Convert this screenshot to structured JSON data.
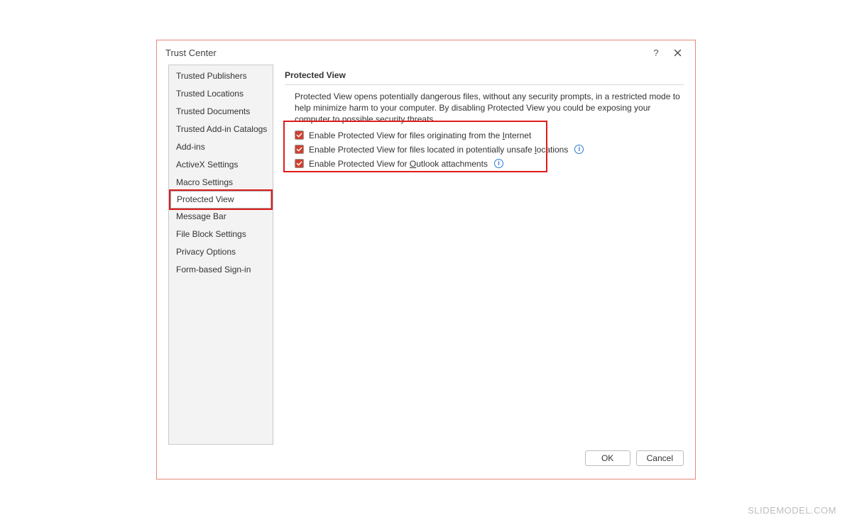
{
  "dialog": {
    "title": "Trust Center",
    "help_tooltip": "?",
    "close_tooltip": "Close"
  },
  "sidebar": {
    "items": [
      {
        "label": "Trusted Publishers"
      },
      {
        "label": "Trusted Locations"
      },
      {
        "label": "Trusted Documents"
      },
      {
        "label": "Trusted Add-in Catalogs"
      },
      {
        "label": "Add-ins"
      },
      {
        "label": "ActiveX Settings"
      },
      {
        "label": "Macro Settings"
      },
      {
        "label": "Protected View",
        "selected": true
      },
      {
        "label": "Message Bar"
      },
      {
        "label": "File Block Settings"
      },
      {
        "label": "Privacy Options"
      },
      {
        "label": "Form-based Sign-in"
      }
    ]
  },
  "main": {
    "section_title": "Protected View",
    "description": "Protected View opens potentially dangerous files, without any security prompts, in a restricted mode to help minimize harm to your computer. By disabling Protected View you could be exposing your computer to possible security threats.",
    "options": [
      {
        "checked": true,
        "label_pre": "Enable Protected View for files originating from the ",
        "accel": "I",
        "label_post": "nternet",
        "info": false
      },
      {
        "checked": true,
        "label_pre": "Enable Protected View for files located in potentially unsafe ",
        "accel": "l",
        "label_post": "ocations",
        "info": true
      },
      {
        "checked": true,
        "label_pre": "Enable Protected View for ",
        "accel": "O",
        "label_post": "utlook attachments",
        "info": true
      }
    ]
  },
  "footer": {
    "ok": "OK",
    "cancel": "Cancel"
  },
  "watermark": "SLIDEMODEL.COM"
}
